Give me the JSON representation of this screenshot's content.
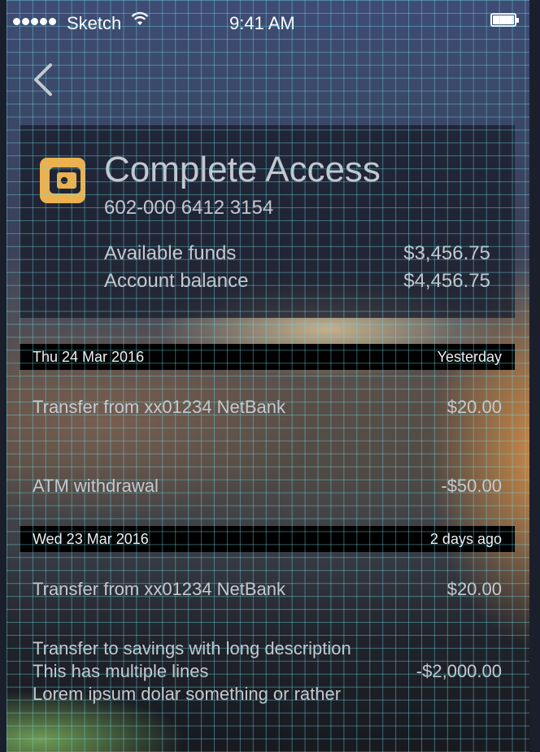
{
  "status_bar": {
    "carrier": "Sketch",
    "time": "9:41 AM"
  },
  "nav": {
    "back_icon": "chevron-left-icon"
  },
  "account": {
    "icon": "wallet-icon",
    "icon_color": "#eeb04c",
    "name": "Complete Access",
    "number": "602-000 6412 3154",
    "available_label": "Available funds",
    "available_value": "$3,456.75",
    "balance_label": "Account balance",
    "balance_value": "$4,456.75"
  },
  "groups": [
    {
      "date": "Thu 24 Mar 2016",
      "relative": "Yesterday",
      "transactions": [
        {
          "description": "Transfer from xx01234 NetBank",
          "amount": "$20.00"
        },
        {
          "description": "ATM withdrawal",
          "amount": "-$50.00"
        }
      ]
    },
    {
      "date": "Wed 23 Mar 2016",
      "relative": "2 days ago",
      "transactions": [
        {
          "description": "Transfer from xx01234 NetBank",
          "amount": "$20.00"
        },
        {
          "description_lines": [
            "Transfer to savings with long description",
            "This has multiple lines",
            "Lorem ipsum dolar something or rather"
          ],
          "amount": "-$2,000.00"
        }
      ]
    }
  ]
}
